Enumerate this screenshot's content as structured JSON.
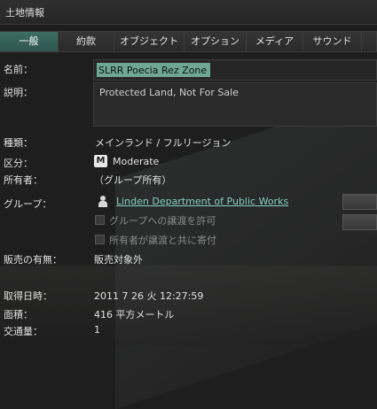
{
  "window": {
    "title": "土地情報"
  },
  "tabs": [
    {
      "label": "一般",
      "active": true
    },
    {
      "label": "約款",
      "active": false
    },
    {
      "label": "オブジェクト",
      "active": false
    },
    {
      "label": "オプション",
      "active": false
    },
    {
      "label": "メディア",
      "active": false
    },
    {
      "label": "サウンド",
      "active": false
    }
  ],
  "fields": {
    "name_label": "名前：",
    "name_value": "SLRR Poecia Rez Zone",
    "description_label": "説明：",
    "description_value": "Protected Land, Not For Sale",
    "type_label": "種類：",
    "type_value": "メインランド / フルリージョン",
    "rating_label": "区分：",
    "rating_badge": "M",
    "rating_value": "Moderate",
    "owner_label": "所有者：",
    "owner_value": "（グループ所有）",
    "group_label": "グループ：",
    "group_value": "Linden Department of Public Works",
    "deed_to_group_label": "グループへの譲渡を許可",
    "owner_contrib_label": "所有者が譲渡と共に寄付",
    "for_sale_label": "販売の有無：",
    "for_sale_value": "販売対象外",
    "acquired_label": "取得日時：",
    "acquired_value": "2011 7 26 火 12:27:59",
    "area_label": "面積：",
    "area_value": "416 平方メートル",
    "traffic_label": "交通量：",
    "traffic_value": "1"
  },
  "colors": {
    "accent_tab": "#3c6d64",
    "name_highlight": "#6ea895",
    "link": "#82d0c0",
    "rating_badge_bg": "#e8e8e8"
  }
}
